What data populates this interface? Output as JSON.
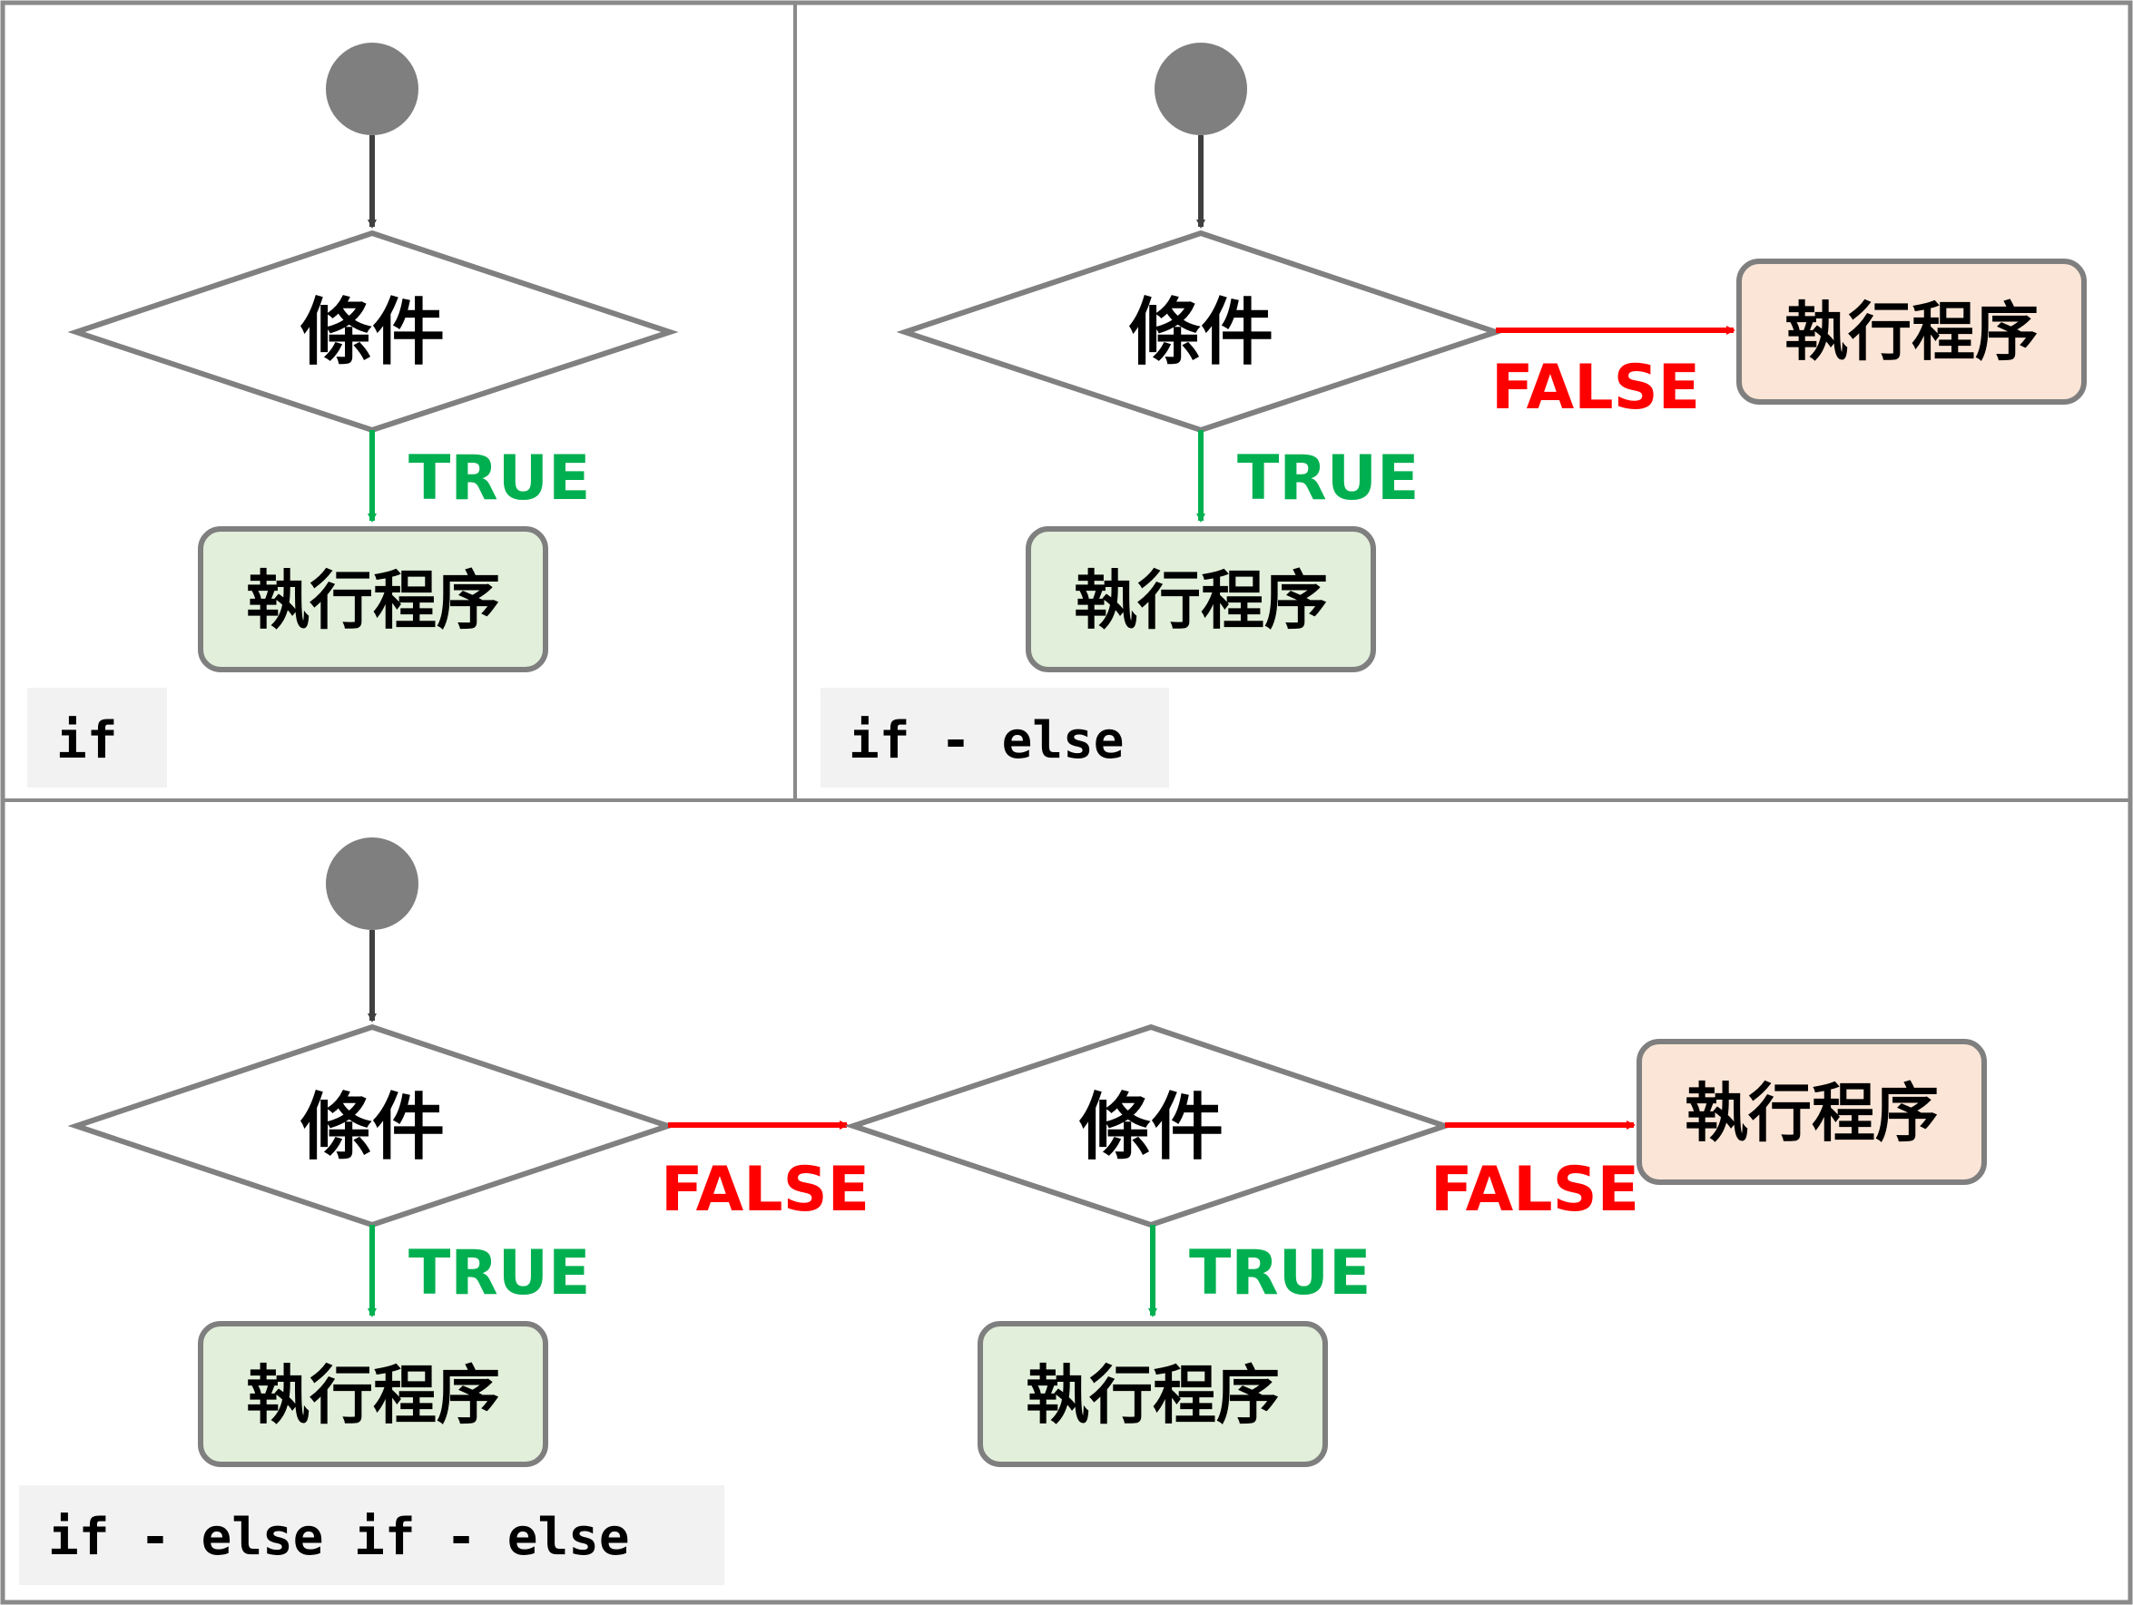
{
  "colors": {
    "panel_border": "#8a8a8a",
    "start_node": "#7f7f7f",
    "decision_stroke": "#808080",
    "true_color": "#00b050",
    "false_color": "#ff0000",
    "true_box_fill": "#e2efda",
    "false_box_fill": "#fbe5d6",
    "box_stroke": "#7f7f7f",
    "label_bg": "#f2f2f2",
    "arrow_dark": "#404040"
  },
  "panels": {
    "if": {
      "caption": "if",
      "condition": "條件",
      "true_label": "TRUE",
      "true_action": "執行程序"
    },
    "if_else": {
      "caption": "if - else",
      "condition": "條件",
      "true_label": "TRUE",
      "true_action": "執行程序",
      "false_label": "FALSE",
      "false_action": "執行程序"
    },
    "if_elseif_else": {
      "caption": "if - else if - else",
      "condition_1": "條件",
      "true_label_1": "TRUE",
      "true_action_1": "執行程序",
      "false_label_1": "FALSE",
      "condition_2": "條件",
      "true_label_2": "TRUE",
      "true_action_2": "執行程序",
      "false_label_2": "FALSE",
      "false_action": "執行程序"
    }
  }
}
